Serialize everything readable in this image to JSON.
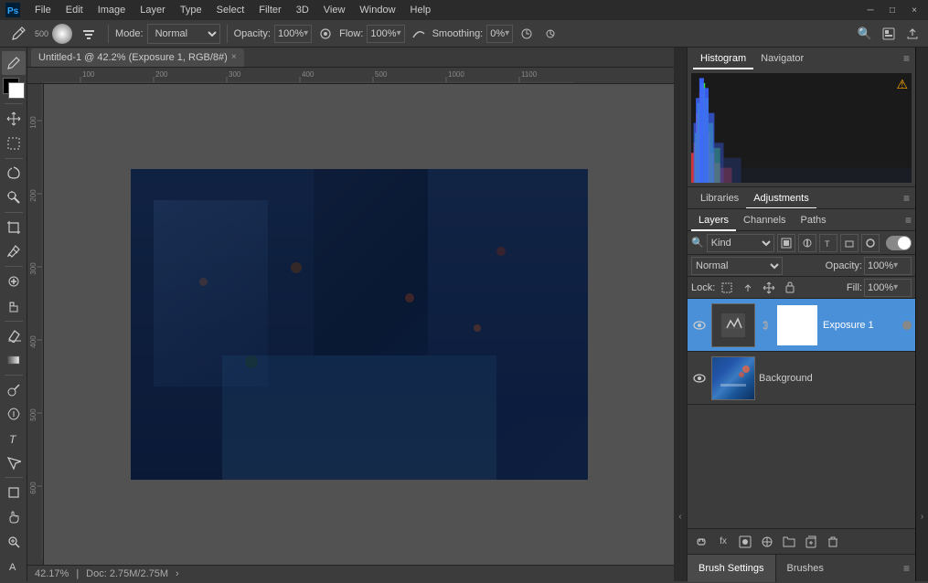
{
  "app": {
    "title": "Adobe Photoshop",
    "icon": "ps"
  },
  "menu": {
    "items": [
      "PS",
      "File",
      "Edit",
      "Image",
      "Layer",
      "Type",
      "Select",
      "Filter",
      "3D",
      "View",
      "Window",
      "Help"
    ]
  },
  "options_bar": {
    "tool_size": "500",
    "mode_label": "Mode:",
    "mode_value": "Normal",
    "opacity_label": "Opacity:",
    "opacity_value": "100%",
    "flow_label": "Flow:",
    "flow_value": "100%",
    "smoothing_label": "Smoothing:",
    "smoothing_value": "0%"
  },
  "tab": {
    "title": "Untitled-1 @ 42.2% (Exposure 1, RGB/8#)",
    "close": "×"
  },
  "histogram": {
    "tabs": [
      "Histogram",
      "Navigator"
    ],
    "active_tab": "Histogram"
  },
  "adjustments": {
    "tabs": [
      "Libraries",
      "Adjustments"
    ],
    "active_tab": "Adjustments"
  },
  "layers_panel": {
    "tabs": [
      "Layers",
      "Channels",
      "Paths"
    ],
    "active_tab": "Layers",
    "filter_label": "Kind",
    "blend_mode": "Normal",
    "opacity_label": "Opacity:",
    "opacity_value": "100%",
    "lock_label": "Lock:",
    "fill_label": "Fill:",
    "fill_value": "100%",
    "layers": [
      {
        "name": "Exposure 1",
        "visible": true,
        "has_mask": true,
        "selected": true,
        "indicator": true
      },
      {
        "name": "Background",
        "visible": true,
        "has_mask": false,
        "selected": false,
        "indicator": false
      }
    ]
  },
  "status_bar": {
    "zoom": "42.17%",
    "doc_size": "Doc: 2.75M/2.75M",
    "arrow": "›"
  },
  "brush_settings": {
    "tabs": [
      "Brush Settings",
      "Brushes"
    ],
    "active_tab": "Brush Settings"
  },
  "icons": {
    "eye": "👁",
    "link": "🔗",
    "menu": "≡",
    "close": "×",
    "warning": "⚠",
    "search": "🔍",
    "filter": "⊟",
    "lock": "🔒",
    "move": "✥",
    "pixels": "⊞",
    "channel": "◎",
    "fx": "fx",
    "mask": "⬜",
    "group": "📁",
    "new_layer": "⊕",
    "trash": "🗑",
    "arrow_right": "›",
    "chevron": "⌄",
    "link_layers": "🔗",
    "adjustments_icon": "◑",
    "stamp": "⊕"
  }
}
